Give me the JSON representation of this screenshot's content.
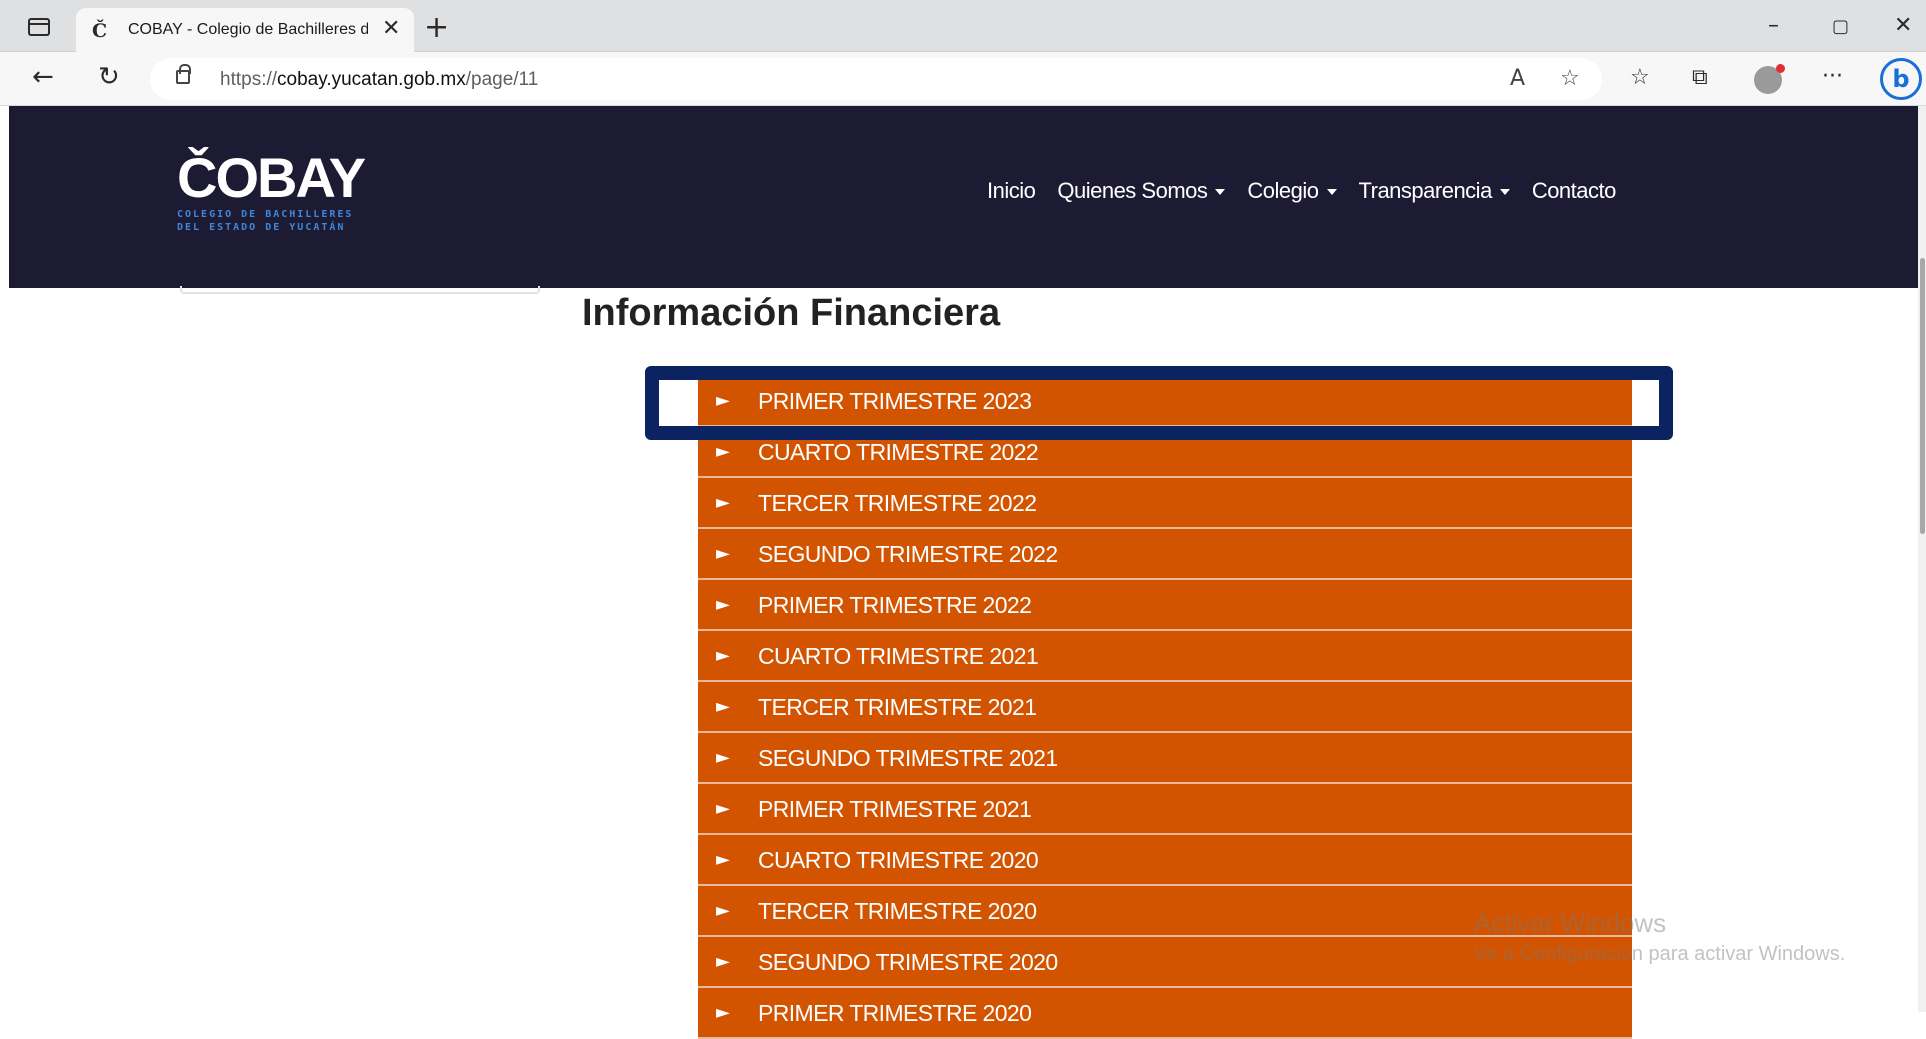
{
  "browser": {
    "tab_title": "COBAY - Colegio de Bachilleres de",
    "tab_favicon": "Č",
    "new_tab": "+",
    "tab_close": "✕",
    "url_scheme": "https://",
    "url_host": "cobay.yucatan.gob.mx",
    "url_path": "/page/11",
    "window_controls": [
      "–",
      "▢",
      "✕"
    ],
    "bing_label": "b"
  },
  "site": {
    "logo_word": "ČOBAY",
    "logo_sub_line1": "COLEGIO DE BACHILLERES",
    "logo_sub_line2": "DEL ESTADO DE YUCATÁN",
    "menu": [
      {
        "label": "Inicio",
        "dropdown": false
      },
      {
        "label": "Quienes Somos",
        "dropdown": true
      },
      {
        "label": "Colegio",
        "dropdown": true
      },
      {
        "label": "Transparencia",
        "dropdown": true
      },
      {
        "label": "Contacto",
        "dropdown": false
      }
    ],
    "page_title": "Información Financiera"
  },
  "accordion": {
    "arrow": "►",
    "items": [
      "PRIMER TRIMESTRE 2023",
      "CUARTO TRIMESTRE 2022",
      "TERCER TRIMESTRE 2022",
      "SEGUNDO TRIMESTRE 2022",
      "PRIMER TRIMESTRE 2022",
      "CUARTO TRIMESTRE 2021",
      "TERCER TRIMESTRE 2021",
      "SEGUNDO TRIMESTRE 2021",
      "PRIMER TRIMESTRE 2021",
      "CUARTO TRIMESTRE 2020",
      "TERCER TRIMESTRE 2020",
      "SEGUNDO TRIMESTRE 2020",
      "PRIMER TRIMESTRE 2020"
    ]
  },
  "watermark": {
    "line1": "Activar Windows",
    "line2": "Ve a Configuración para activar Windows."
  },
  "colors": {
    "header_bg": "#1d1b33",
    "accordion_bg": "#d35400",
    "highlight_border": "#0b2360"
  }
}
